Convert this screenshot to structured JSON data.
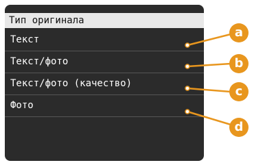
{
  "screen": {
    "title": "Тип оригинала",
    "items": [
      {
        "label": "Текст",
        "callout": "a"
      },
      {
        "label": "Текст/фото",
        "callout": "b"
      },
      {
        "label": "Текст/фото (качество)",
        "callout": "c"
      },
      {
        "label": "Фото",
        "callout": "d"
      }
    ]
  },
  "colors": {
    "screen_bg": "#2b2b2b",
    "title_bg": "#e8e8e8",
    "callout": "#e8961e"
  }
}
